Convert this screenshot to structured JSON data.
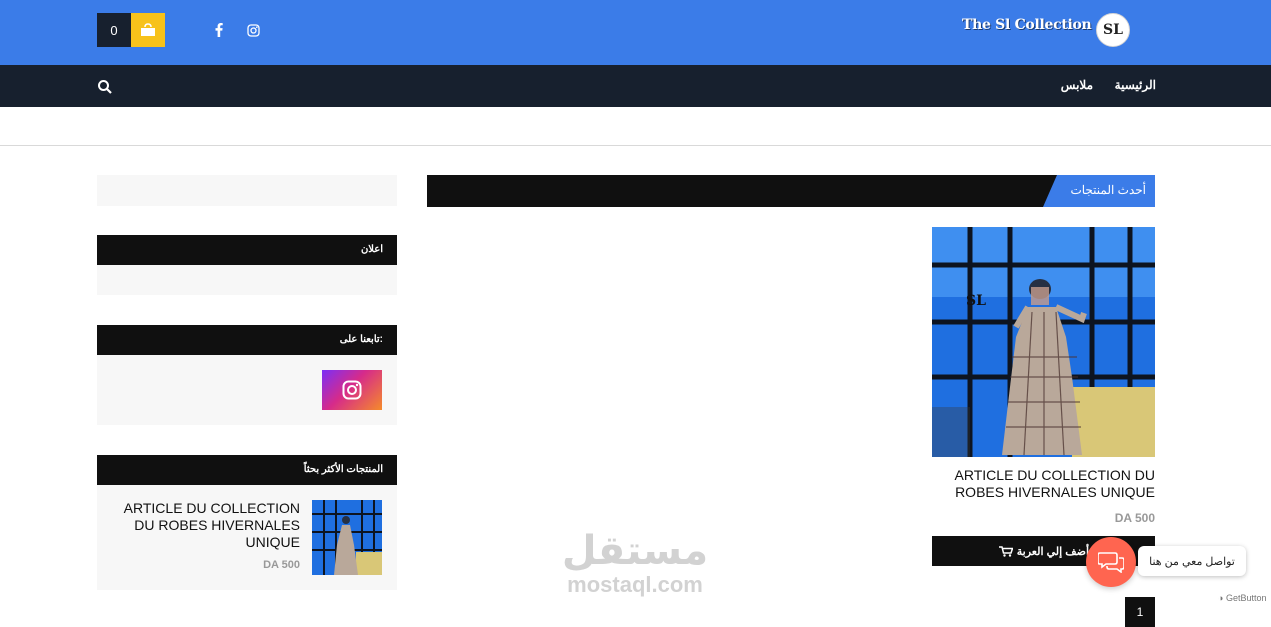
{
  "header": {
    "cart_count": "0",
    "logo_text": "The Sl Collection",
    "logo_mark": "SL",
    "icons": [
      "shopping-bag-icon",
      "facebook-icon",
      "instagram-icon"
    ]
  },
  "nav": {
    "items": [
      {
        "label": "الرئيسية"
      },
      {
        "label": "ملابس"
      }
    ],
    "search_icon": "search-icon"
  },
  "main": {
    "section_title": "أحدث المنتجات",
    "product": {
      "name": "ARTICLE DU COLLECTION DU ROBES HIVERNALES UNIQUE",
      "price": "DA 500",
      "add_to_cart": "أضف إلي العربة"
    },
    "page": "1"
  },
  "sidebar": {
    "ads_title": "اعلان",
    "follow_title": "تابعنا على:",
    "best_title": "المنتجات الأكثر بحثاً",
    "best_product": {
      "name": "ARTICLE DU COLLECTION DU ROBES HIVERNALES UNIQUE",
      "price": "DA 500"
    }
  },
  "watermark": {
    "arabic": "مستقل",
    "latin": "mostaql.com"
  },
  "chat_widget": {
    "label": "تواصل معي من هنا",
    "powered": "GetButton"
  },
  "colors": {
    "header_blue": "#3b7ce8",
    "nav_dark": "#17202e",
    "accent_yellow": "#f7c21a",
    "chat_orange": "#ff6550"
  }
}
